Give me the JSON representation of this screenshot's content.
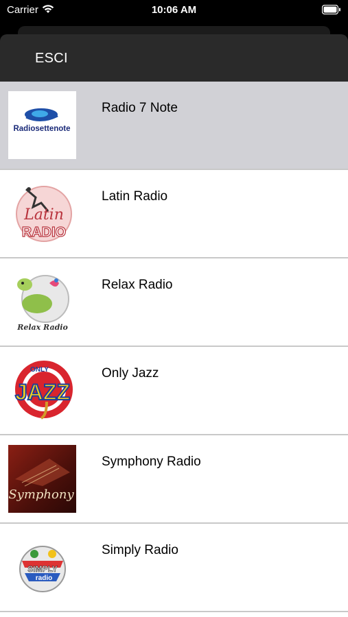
{
  "status_bar": {
    "carrier": "Carrier",
    "time": "10:06 AM"
  },
  "nav": {
    "close_label": "ESCI"
  },
  "stations": [
    {
      "name": "Radio 7 Note",
      "logo_text": "Radiosettenote",
      "logo_icon": "radio-7-note-logo",
      "selected": true
    },
    {
      "name": "Latin Radio",
      "logo_text": "Latin RADIO",
      "logo_icon": "latin-radio-logo",
      "selected": false
    },
    {
      "name": "Relax Radio",
      "logo_text": "Relax Radio",
      "logo_icon": "relax-radio-logo",
      "selected": false
    },
    {
      "name": "Only Jazz",
      "logo_text": "ONLY JAZZ",
      "logo_icon": "only-jazz-logo",
      "selected": false
    },
    {
      "name": "Symphony Radio",
      "logo_text": "Symphony",
      "logo_icon": "symphony-radio-logo",
      "selected": false
    },
    {
      "name": "Simply Radio",
      "logo_text": "SIMPLY radio",
      "logo_icon": "simply-radio-logo",
      "selected": false
    }
  ],
  "colors": {
    "selected_row": "#d1d1d6",
    "nav_bar": "#2a2a2a",
    "separator": "#c8c8c8"
  }
}
